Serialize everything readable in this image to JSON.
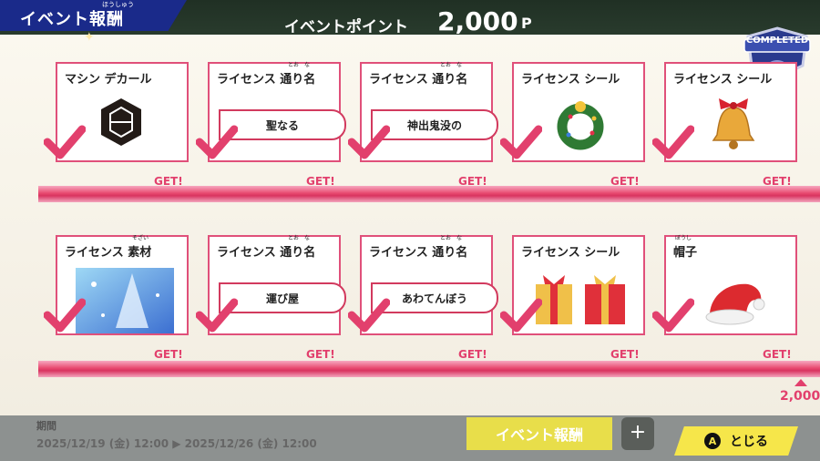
{
  "header": {
    "title": "イベント報酬",
    "title_ruby": "ほうしゅう",
    "points_label": "イベントポイント",
    "points_value": "2,000",
    "points_unit": "P"
  },
  "badge": {
    "label": "COMPLETED"
  },
  "rewards_row1": [
    {
      "type": "マシン デカール",
      "icon": "gem-decal-icon",
      "get": "GET!"
    },
    {
      "type": "ライセンス 通り名",
      "ruby": "とお　な",
      "nickname": "聖なる",
      "get": "GET!"
    },
    {
      "type": "ライセンス 通り名",
      "ruby": "とお　な",
      "nickname": "神出鬼没の",
      "get": "GET!"
    },
    {
      "type": "ライセンス シール",
      "icon": "wreath-icon",
      "get": "GET!"
    },
    {
      "type": "ライセンス シール",
      "icon": "bell-icon",
      "get": "GET!"
    }
  ],
  "rewards_row2": [
    {
      "type": "ライセンス 素材",
      "ruby": "そざい",
      "icon": "tree-material-icon",
      "get": "GET!"
    },
    {
      "type": "ライセンス 通り名",
      "ruby": "とお　な",
      "nickname": "運び屋",
      "get": "GET!"
    },
    {
      "type": "ライセンス 通り名",
      "ruby": "とお　な",
      "nickname": "あわてんぼう",
      "get": "GET!"
    },
    {
      "type": "ライセンス シール",
      "icon": "gifts-icon",
      "get": "GET!"
    },
    {
      "type": "帽子",
      "ruby": "ぼうし",
      "icon": "santa-hat-icon",
      "get": "GET!"
    }
  ],
  "total_points": "2,000",
  "footer": {
    "period_label": "期間",
    "period_range": "2025/12/19 (金) 12:00 ▶ 2025/12/26 (金) 12:00",
    "event_button": "イベント報酬",
    "plus_button": "+",
    "close_key": "A",
    "close_label": "とじる"
  },
  "colors": {
    "accent": "#e2406d",
    "header_tab": "#1a2a8a",
    "close_button": "#f6e64a"
  }
}
